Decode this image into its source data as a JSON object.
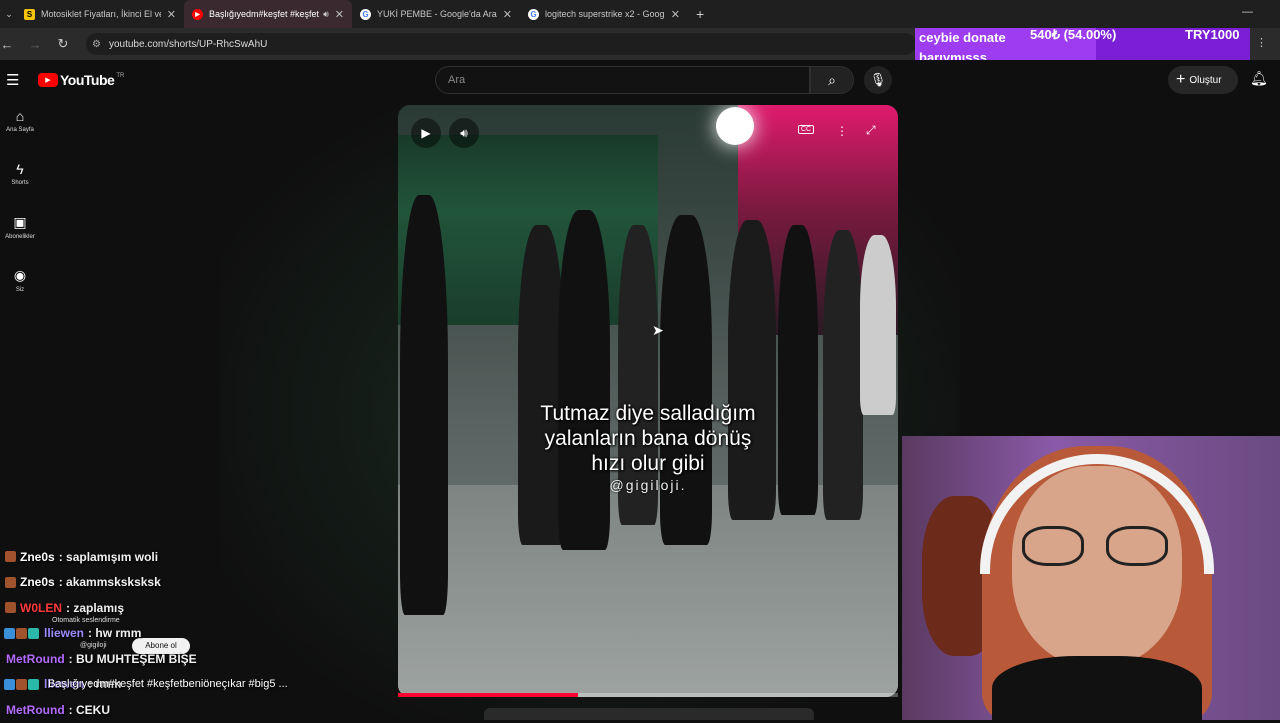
{
  "browser": {
    "tabs": [
      {
        "title": "Motosiklet Fiyatları, İkinci El ve",
        "favicon": "S",
        "fav_color": "#f5c400",
        "active": false
      },
      {
        "title": "Başlığıyedm#keşfet #keşfet",
        "favicon": "▶",
        "fav_color": "#ff0000",
        "active": true
      },
      {
        "title": "YUKİ PEMBE - Google'da Ara",
        "favicon": "G",
        "fav_color": "#ffffff",
        "active": false
      },
      {
        "title": "logitech superstrike x2 - Google",
        "favicon": "G",
        "fav_color": "#ffffff",
        "active": false
      }
    ],
    "new_tab": "+",
    "url": "youtube.com/shorts/UP-RhcSwAhU"
  },
  "donation": {
    "label": "ceybie donate barıymısss",
    "amount": "540₺ (54.00%)",
    "goal": "TRY1000",
    "progress_fraction": 0.54
  },
  "header": {
    "logo_text": "YouTube",
    "country_code": "TR",
    "search_placeholder": "Ara",
    "create_label": "Oluştur"
  },
  "guide": [
    {
      "label": "Ana Sayfa",
      "icon": "home-icon",
      "glyph": "⌂"
    },
    {
      "label": "Shorts",
      "icon": "shorts-icon",
      "glyph": "ϟ"
    },
    {
      "label": "Abonelikler",
      "icon": "subscriptions-icon",
      "glyph": "▣"
    },
    {
      "label": "Siz",
      "icon": "you-icon",
      "glyph": "◉"
    }
  ],
  "video": {
    "caption_lines": [
      "Tutmaz diye salladığım",
      "yalanların bana dönüş",
      "hızı olur gibi"
    ],
    "handle": "@gigiloji.",
    "progress_fraction": 0.36,
    "auto_dub": "Otomatik seslendirme",
    "channel": "@gigiloji",
    "subscribe": "Abone ol",
    "title": "Başlığıyedm#keşfet #keşfetbeniöneçıkar #big5 ..."
  },
  "chat": [
    {
      "user": "Zne0s",
      "message": "saplamışım woli",
      "color": "#ffffff"
    },
    {
      "user": "Zne0s",
      "message": "akammsksksksk",
      "color": "#ffffff"
    },
    {
      "user": "W0LEN",
      "message": "zaplamış",
      "color": "#ff3b3b"
    },
    {
      "user": "lliewen",
      "message": "hw rmm",
      "color": "#9b8cff"
    },
    {
      "user": "MetRound",
      "message": "BU MUHTEŞEM BİŞE",
      "color": "#b46cff"
    },
    {
      "user": "lliewen",
      "message": "rmm",
      "color": "#9b8cff"
    },
    {
      "user": "MetRound",
      "message": "CEKU",
      "color": "#b46cff"
    }
  ]
}
